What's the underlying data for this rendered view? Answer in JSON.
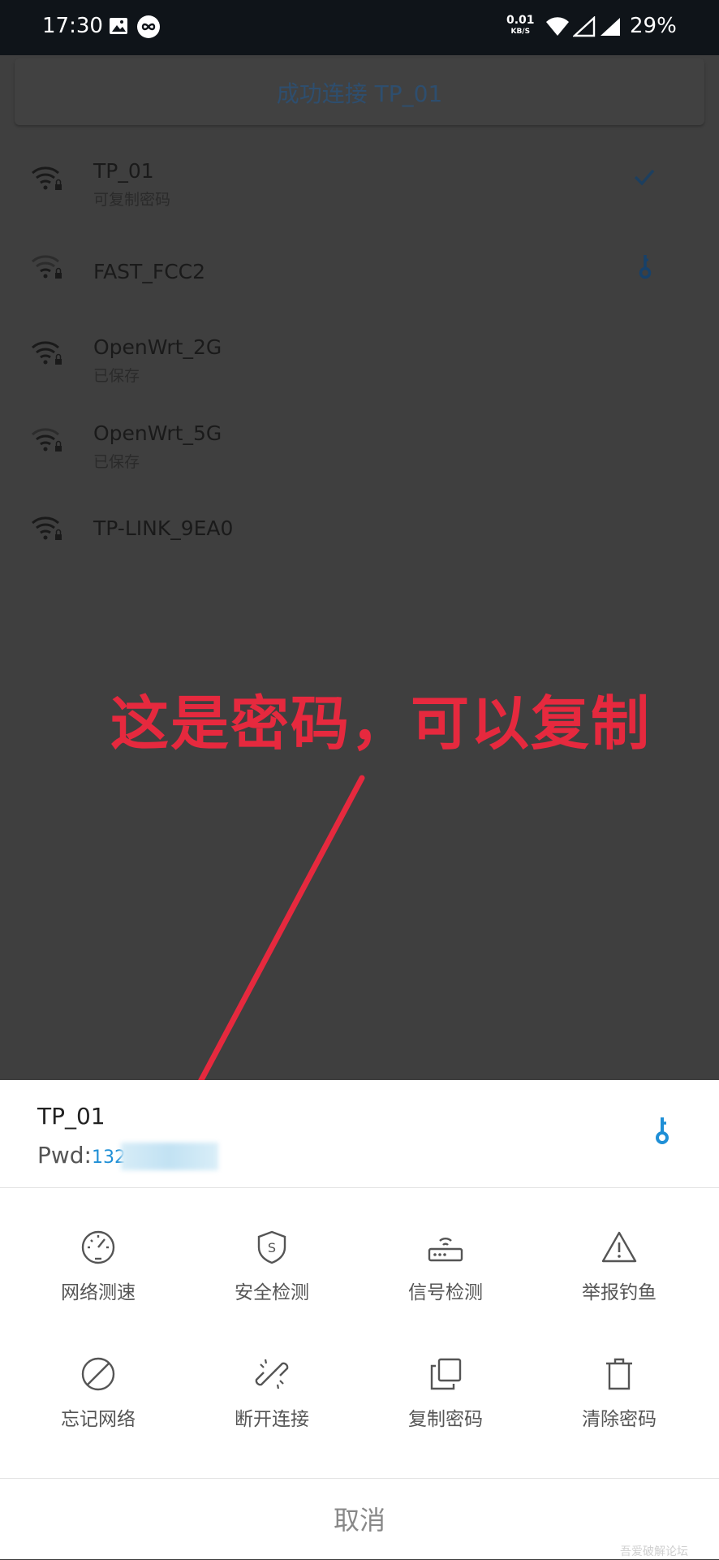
{
  "status_bar": {
    "time": "17:30",
    "speed_value": "0.01",
    "speed_unit": "KB/S",
    "battery": "29%"
  },
  "banner": {
    "text": "成功连接 TP_01"
  },
  "networks": [
    {
      "ssid": "TP_01",
      "subtitle": "可复制密码",
      "right_icon": "check-icon"
    },
    {
      "ssid": "FAST_FCC2",
      "subtitle": "",
      "right_icon": "key-icon"
    },
    {
      "ssid": "OpenWrt_2G",
      "subtitle": "已保存",
      "right_icon": ""
    },
    {
      "ssid": "OpenWrt_5G",
      "subtitle": "已保存",
      "right_icon": ""
    },
    {
      "ssid": "TP-LINK_9EA0",
      "subtitle": "",
      "right_icon": ""
    }
  ],
  "annotation": {
    "text": "这是密码，可以复制",
    "color": "#e6293e"
  },
  "sheet": {
    "ssid": "TP_01",
    "pwd_label": "Pwd:",
    "pwd_value": "132",
    "actions": [
      {
        "label": "网络测速",
        "icon": "speedometer-icon"
      },
      {
        "label": "安全检测",
        "icon": "shield-icon"
      },
      {
        "label": "信号检测",
        "icon": "router-icon"
      },
      {
        "label": "举报钓鱼",
        "icon": "warning-icon"
      },
      {
        "label": "忘记网络",
        "icon": "forbidden-icon"
      },
      {
        "label": "断开连接",
        "icon": "broken-link-icon"
      },
      {
        "label": "复制密码",
        "icon": "copy-icon"
      },
      {
        "label": "清除密码",
        "icon": "trash-icon"
      }
    ],
    "cancel_label": "取消"
  },
  "watermark": "吾爱破解论坛",
  "colors": {
    "accent": "#1f8fd6",
    "annotation": "#e6293e",
    "status_bar": "#0f1419"
  }
}
